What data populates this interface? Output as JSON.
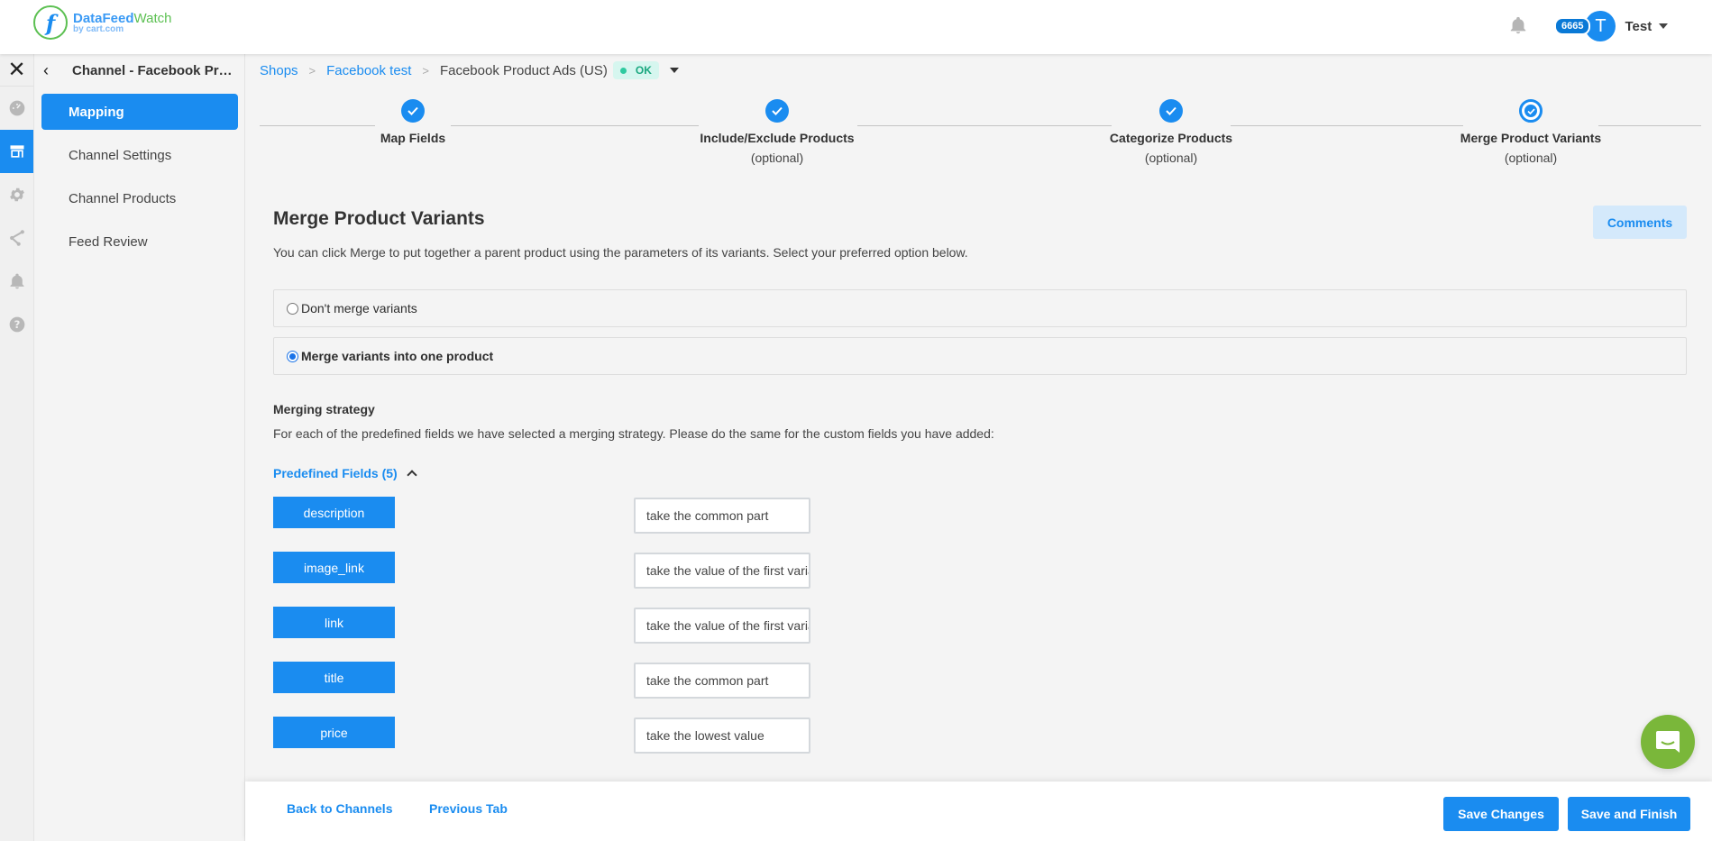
{
  "header": {
    "logo_name_primary": "DataFeed",
    "logo_name_secondary": "Watch",
    "logo_sub": "by cart.com",
    "logo_mark": "f",
    "credits": "6665",
    "avatar_initial": "T",
    "user_name": "Test"
  },
  "rail": {
    "close_icon": "✕",
    "items": [
      {
        "icon": "dashboard-icon",
        "active": false
      },
      {
        "icon": "shop-icon",
        "active": true
      },
      {
        "icon": "gear-icon",
        "active": false
      },
      {
        "icon": "share-icon",
        "active": false
      },
      {
        "icon": "bell-icon",
        "active": false
      },
      {
        "icon": "help-icon",
        "active": false
      }
    ]
  },
  "sidebar": {
    "back_icon": "‹",
    "title": "Channel - Facebook Product Ads (US)",
    "items": [
      {
        "label": "Mapping",
        "active": true
      },
      {
        "label": "Channel Settings",
        "active": false
      },
      {
        "label": "Channel Products",
        "active": false
      },
      {
        "label": "Feed Review",
        "active": false
      }
    ]
  },
  "breadcrumb": {
    "items": [
      "Shops",
      "Facebook test"
    ],
    "separator": ">",
    "current": "Facebook Product Ads (US)",
    "status": "OK"
  },
  "stepper": {
    "steps": [
      {
        "label": "Map Fields",
        "sub": "",
        "state": "done"
      },
      {
        "label": "Include/Exclude Products",
        "sub": "(optional)",
        "state": "done"
      },
      {
        "label": "Categorize Products",
        "sub": "(optional)",
        "state": "done"
      },
      {
        "label": "Merge Product Variants",
        "sub": "(optional)",
        "state": "current"
      }
    ]
  },
  "main": {
    "title": "Merge Product Variants",
    "description": "You can click Merge to put together a parent product using the parameters of its variants. Select your preferred option below.",
    "comments_label": "Comments",
    "options": [
      {
        "label": "Don't merge variants",
        "checked": false
      },
      {
        "label": "Merge variants into one product",
        "checked": true
      }
    ],
    "merging_strategy_title": "Merging strategy",
    "merging_strategy_desc": "For each of the predefined fields we have selected a merging strategy. Please do the same for the custom fields you have added:",
    "predefined_label": "Predefined Fields (5)",
    "fields": [
      {
        "name": "description",
        "strategy": "take the common part"
      },
      {
        "name": "image_link",
        "strategy": "take the value of the first variant"
      },
      {
        "name": "link",
        "strategy": "take the value of the first variant"
      },
      {
        "name": "title",
        "strategy": "take the common part"
      },
      {
        "name": "price",
        "strategy": "take the lowest value"
      }
    ]
  },
  "footer": {
    "back_label": "Back to Channels",
    "previous_label": "Previous Tab",
    "save_label": "Save Changes",
    "save_finish_label": "Save and Finish"
  },
  "colors": {
    "accent": "#1a8cf0",
    "ok_bg": "#d6f6ef",
    "ok_text": "#1aa77f",
    "chat": "#7ab73a",
    "logo_green": "#5cc052"
  }
}
